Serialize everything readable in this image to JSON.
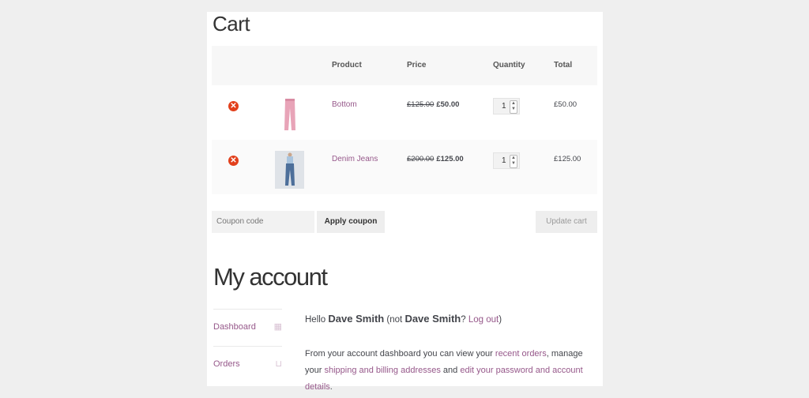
{
  "cart": {
    "title": "Cart",
    "headers": {
      "product": "Product",
      "price": "Price",
      "quantity": "Quantity",
      "total": "Total"
    },
    "items": [
      {
        "name": "Bottom",
        "old_price": "£125.00",
        "price": "£50.00",
        "qty": "1",
        "total": "£50.00",
        "image": "pink-trousers"
      },
      {
        "name": "Denim Jeans",
        "old_price": "£200.00",
        "price": "£125.00",
        "qty": "1",
        "total": "£125.00",
        "image": "denim-jeans"
      }
    ],
    "coupon_placeholder": "Coupon code",
    "apply_label": "Apply coupon",
    "update_label": "Update cart"
  },
  "account": {
    "title": "My account",
    "nav": [
      {
        "label": "Dashboard",
        "icon": "dashboard-icon"
      },
      {
        "label": "Orders",
        "icon": "basket-icon"
      }
    ],
    "hello_prefix": "Hello ",
    "user": "Dave Smith",
    "not_prefix": " (not ",
    "user2": "Dave Smith",
    "q": "? ",
    "logout": "Log out",
    "close": ")",
    "desc_1": "From your account dashboard you can view your ",
    "link_orders": "recent orders",
    "desc_2": ", manage your ",
    "link_addresses": "shipping and billing addresses",
    "desc_3": " and ",
    "link_edit": "edit your password and account details",
    "desc_4": "."
  },
  "colors": {
    "accent": "#96588a",
    "remove": "#e2401c",
    "background": "#efefef"
  }
}
